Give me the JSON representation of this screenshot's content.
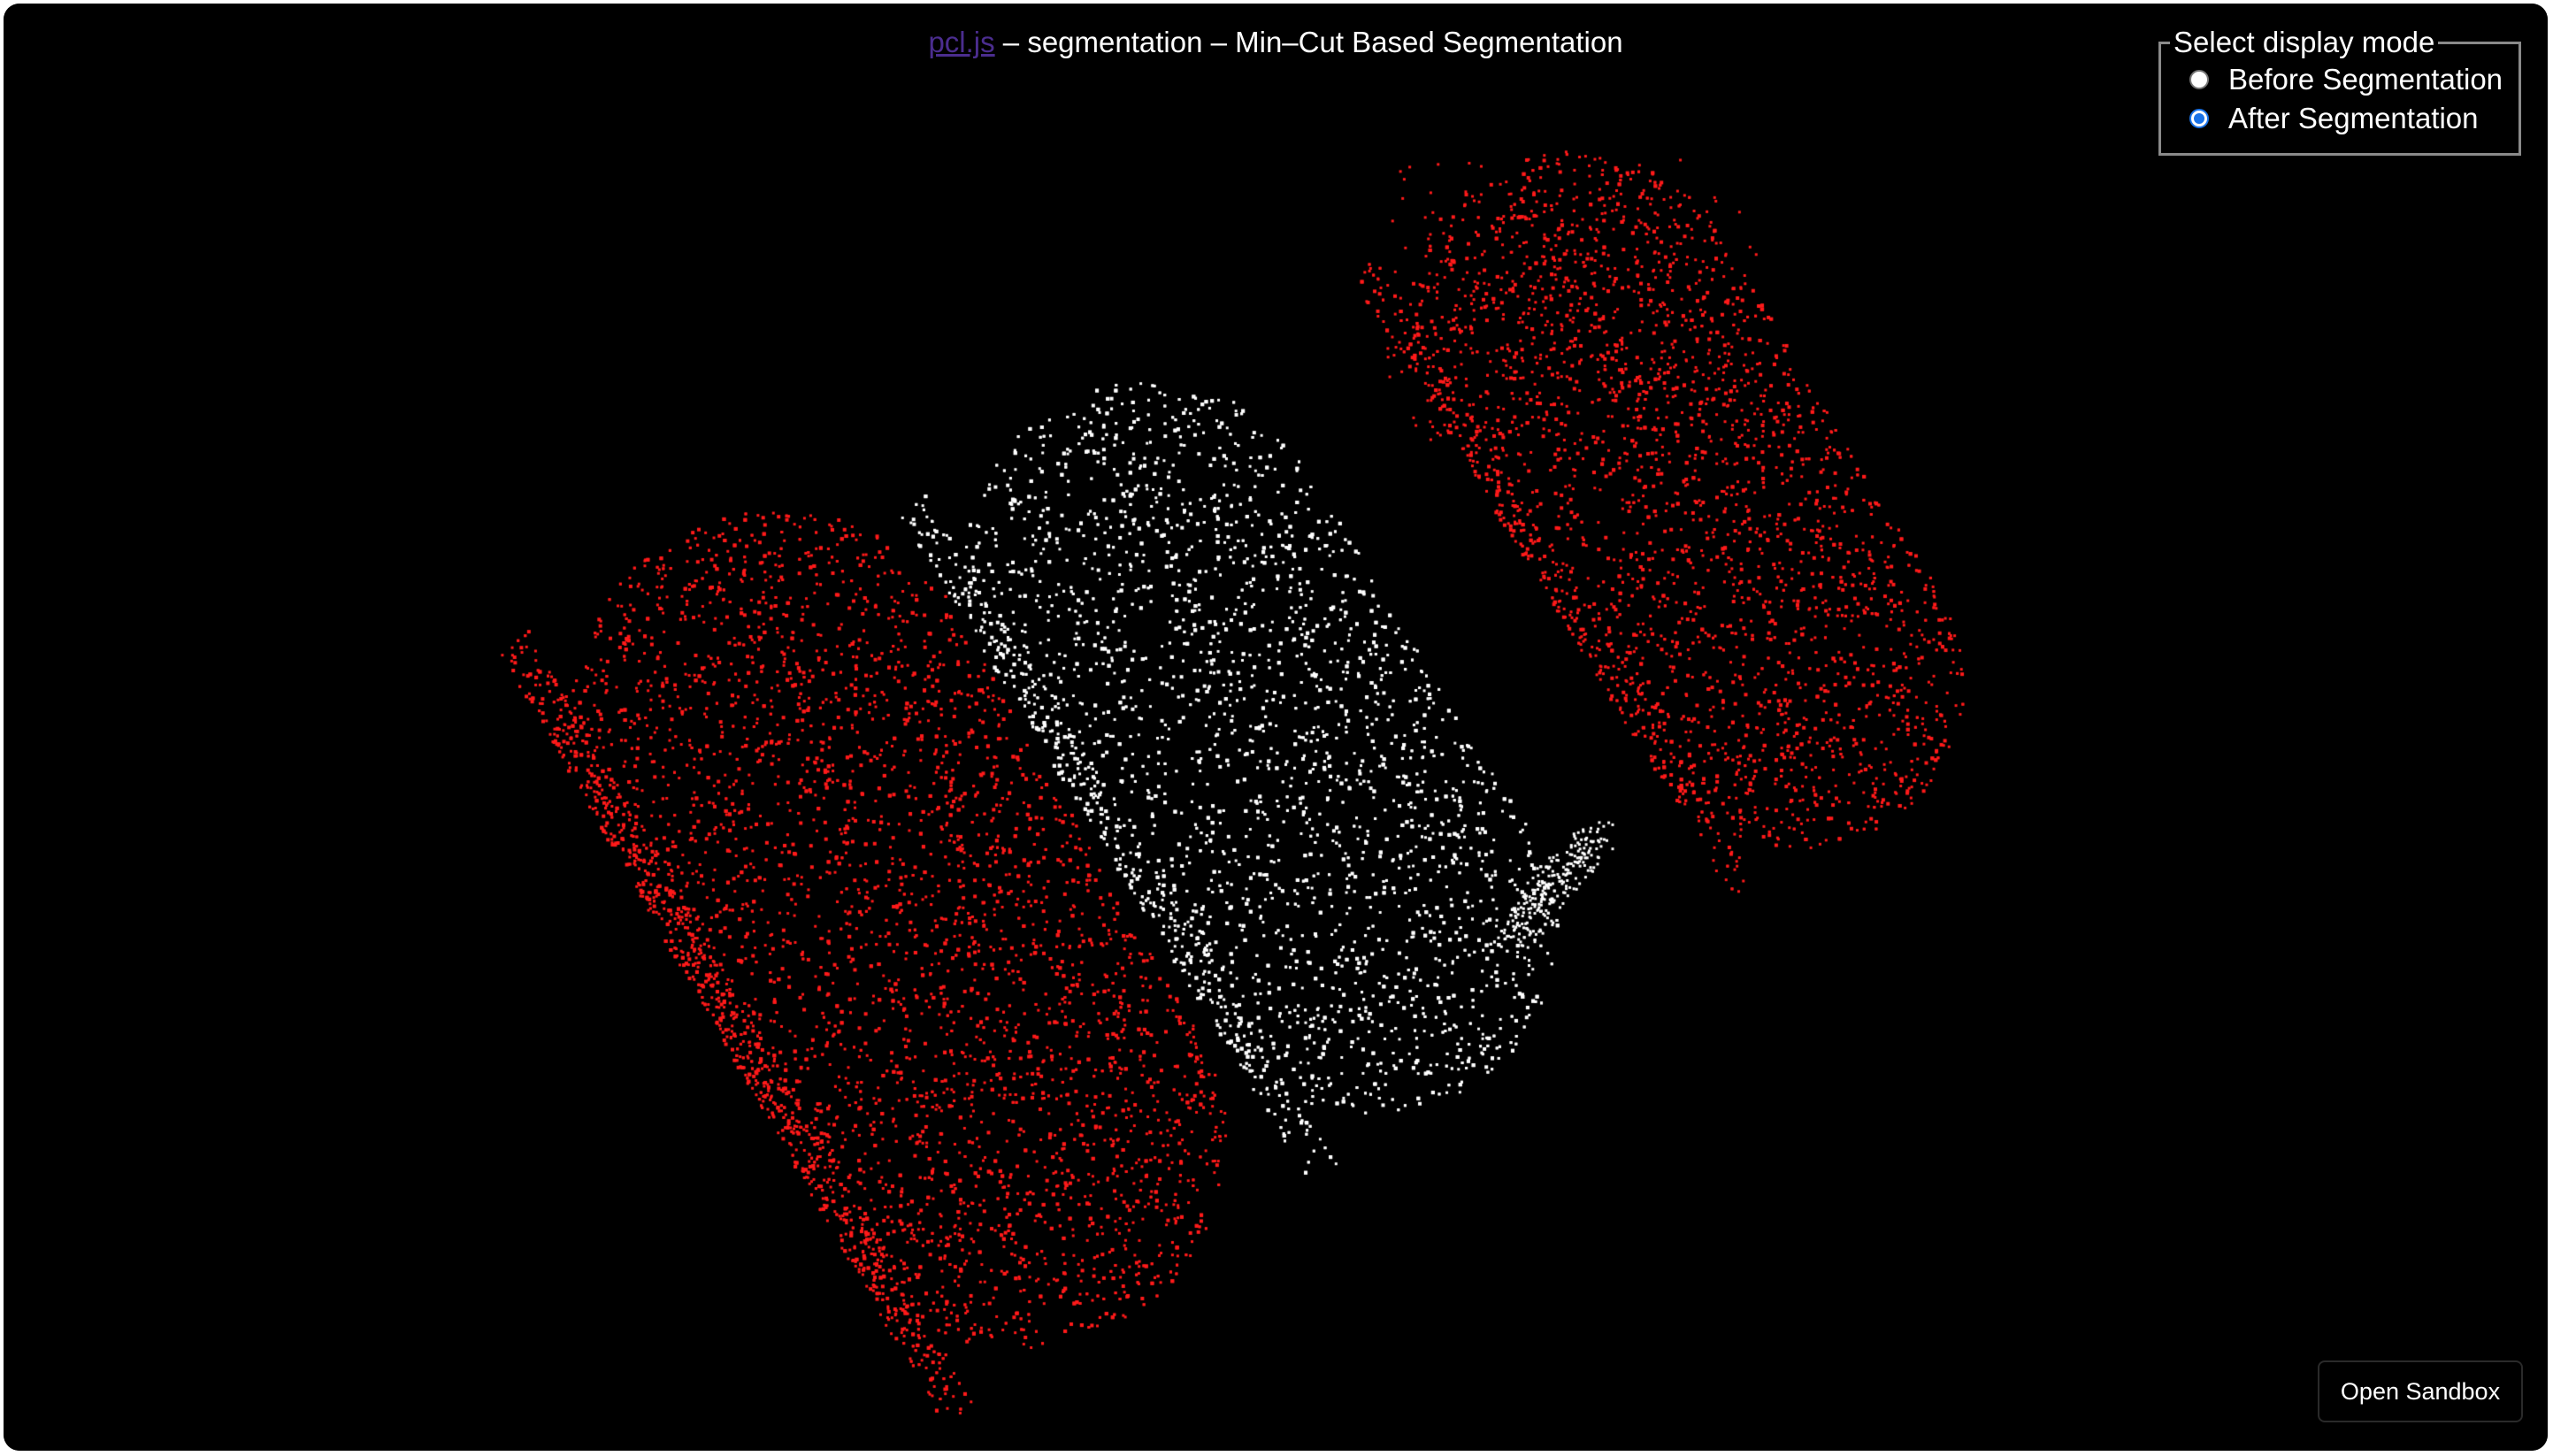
{
  "header": {
    "link_text": "pcl.js",
    "title_rest": " – segmentation – Min–Cut Based Segmentation"
  },
  "display_mode": {
    "legend": "Select display mode",
    "options": [
      {
        "label": "Before Segmentation",
        "checked": false
      },
      {
        "label": "After Segmentation",
        "checked": true
      }
    ]
  },
  "sandbox_button": {
    "label": "Open Sandbox"
  },
  "viewer": {
    "background": "#000000",
    "foreground_color": "#ffffff",
    "background_cluster_color": "#ff1a1a",
    "link_color": "#4b2d8f",
    "radio_accent": "#1a73e8"
  }
}
